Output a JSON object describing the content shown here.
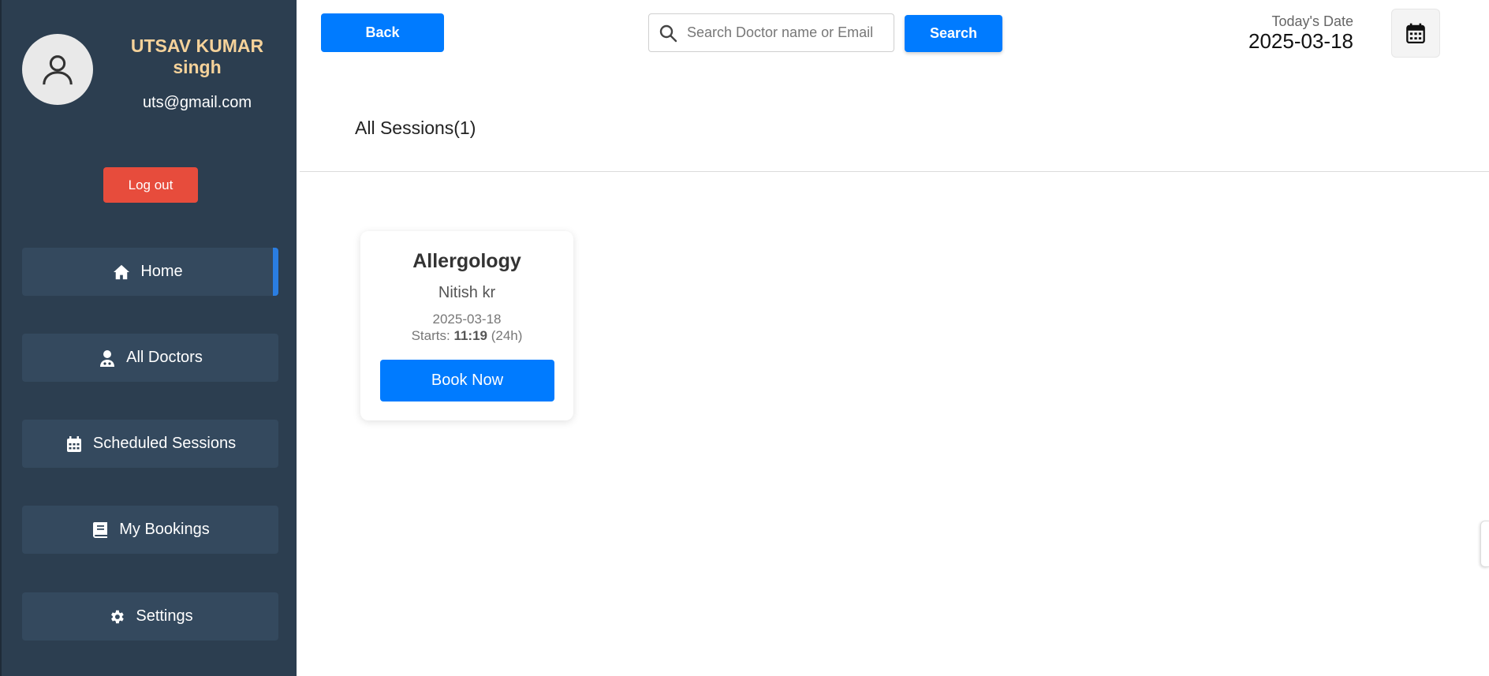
{
  "user": {
    "name_line1": "UTSAV KUMAR",
    "name_line2": "singh",
    "email": "uts@gmail.com",
    "avatar_icon": "user-icon"
  },
  "sidebar": {
    "logout_label": "Log out",
    "items": [
      {
        "label": "Home",
        "icon": "home-icon",
        "active": true
      },
      {
        "label": "All Doctors",
        "icon": "doctor-icon",
        "active": false
      },
      {
        "label": "Scheduled Sessions",
        "icon": "calendar-icon",
        "active": false
      },
      {
        "label": "My Bookings",
        "icon": "book-icon",
        "active": false
      },
      {
        "label": "Settings",
        "icon": "gear-icon",
        "active": false
      }
    ]
  },
  "header": {
    "back_label": "Back",
    "search_placeholder": "Search Doctor name or Email",
    "search_label": "Search",
    "date_label": "Today's Date",
    "date_value": "2025-03-18"
  },
  "main": {
    "section_title": "All Sessions(1)",
    "sessions": [
      {
        "title": "Allergology",
        "doctor": "Nitish kr",
        "date": "2025-03-18",
        "starts_prefix": "Starts: ",
        "time": "11:19",
        "time_suffix": " (24h)",
        "book_label": "Book Now"
      }
    ]
  },
  "colors": {
    "sidebar_bg": "#2c3e50",
    "nav_item_bg": "#34495e",
    "primary": "#007bff",
    "logout": "#e74c3c",
    "user_name": "#f5d29a",
    "active_indicator": "#2a7de1"
  }
}
